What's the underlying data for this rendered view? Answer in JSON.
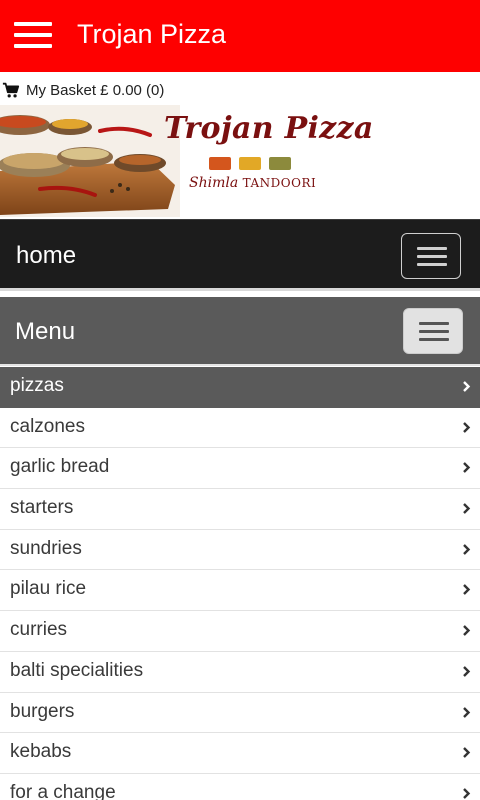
{
  "appbar": {
    "title": "Trojan Pizza",
    "menu_icon": "hamburger-menu-icon",
    "background": "#fe0000"
  },
  "basket": {
    "icon": "shopping-cart-icon",
    "text": "My Basket £ 0.00 (0)"
  },
  "banner": {
    "title": "Trojan Pizza",
    "subtitle_script": "Shimla",
    "subtitle_caps": "TANDOORI",
    "accent": "#7a1010"
  },
  "navbar": {
    "label": "home",
    "toggle_icon": "hamburger-toggle-icon"
  },
  "menu": {
    "title": "Menu",
    "toggle_icon": "hamburger-toggle-icon",
    "items": [
      {
        "label": "pizzas",
        "active": true
      },
      {
        "label": "calzones"
      },
      {
        "label": "garlic bread"
      },
      {
        "label": "starters"
      },
      {
        "label": "sundries"
      },
      {
        "label": "pilau rice"
      },
      {
        "label": "curries"
      },
      {
        "label": "balti specialities"
      },
      {
        "label": "burgers"
      },
      {
        "label": "kebabs"
      },
      {
        "label": "for a change"
      }
    ]
  }
}
